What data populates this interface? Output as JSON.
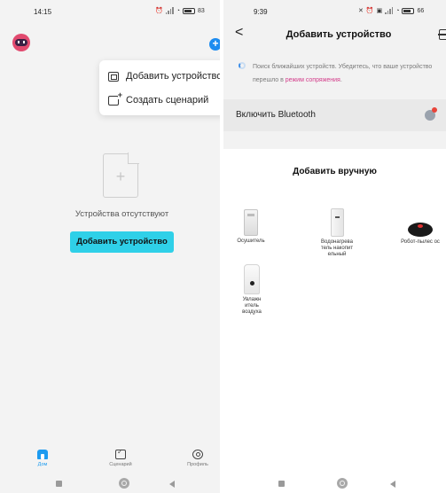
{
  "left_screen": {
    "status": {
      "time": "14:15",
      "battery": "83"
    },
    "menu": {
      "items": [
        {
          "label": "Добавить устройство",
          "icon": "add-device-icon"
        },
        {
          "label": "Создать сценарий",
          "icon": "create-scene-icon"
        }
      ]
    },
    "empty_state": {
      "message": "Устройства отсутствуют",
      "button_label": "Добавить устройство"
    },
    "tabbar": {
      "tabs": [
        {
          "label": "Дом",
          "active": true,
          "icon": "home-icon"
        },
        {
          "label": "Сценарий",
          "active": false,
          "icon": "scenario-icon"
        },
        {
          "label": "Профиль",
          "active": false,
          "icon": "profile-icon"
        }
      ]
    }
  },
  "right_screen": {
    "status": {
      "time": "9:39",
      "battery": "66"
    },
    "title": "Добавить устройство",
    "search": {
      "text": "Поиск ближайших устройств. Убедитесь, что ваше устройство перешло в",
      "link": "режим сопряжения",
      "suffix": "."
    },
    "bluetooth": {
      "label": "Включить Bluetooth"
    },
    "manual": {
      "title": "Добавить вручную",
      "devices": [
        {
          "name": "Осушитель",
          "icon": "dehumidifier-icon"
        },
        {
          "name": "Водонагрева тель накопит ельный",
          "icon": "water-heater-icon"
        },
        {
          "name": "Робот-пылес ос",
          "icon": "robot-vacuum-icon"
        },
        {
          "name": "Увлажн итель воздуха",
          "icon": "humidifier-icon"
        }
      ]
    }
  },
  "colors": {
    "accent_blue": "#1d8cf0",
    "cyan_button": "#2fd0e8",
    "link_pink": "#d33c8a",
    "alert_red": "#e8443a"
  }
}
